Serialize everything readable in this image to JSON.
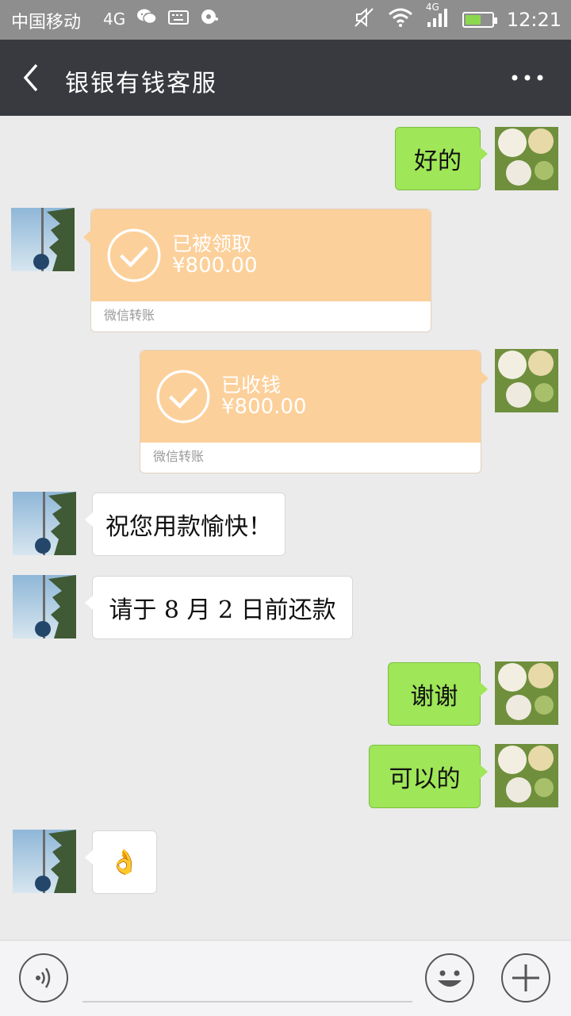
{
  "status_bar": {
    "carrier": "中国移动",
    "network_label": "4G",
    "signal_label": "4G",
    "time": "12:21",
    "battery_level": 0.6,
    "icons": [
      "wechat-icon",
      "keyboard-icon",
      "disk-icon",
      "mute-icon",
      "wifi-icon",
      "signal-icon",
      "battery-icon"
    ]
  },
  "header": {
    "title": "银银有钱客服",
    "back_icon": "chevron-left-icon",
    "more_icon": "more-dots-icon"
  },
  "messages": [
    {
      "side": "right",
      "type": "text",
      "text": "好的"
    },
    {
      "side": "left",
      "type": "transfer",
      "status": "已被领取",
      "amount": "¥800.00",
      "footer": "微信转账"
    },
    {
      "side": "right",
      "type": "transfer",
      "status": "已收钱",
      "amount": "¥800.00",
      "footer": "微信转账"
    },
    {
      "side": "left",
      "type": "text",
      "text": "祝您用款愉快！"
    },
    {
      "side": "left",
      "type": "text",
      "text": "请于 8 月 2 日前还款"
    },
    {
      "side": "right",
      "type": "text",
      "text": "谢谢"
    },
    {
      "side": "right",
      "type": "text",
      "text": "可以的"
    },
    {
      "side": "left",
      "type": "emoji",
      "text": "👌"
    }
  ],
  "input_bar": {
    "voice_icon": "voice-icon",
    "emoji_icon": "emoji-icon",
    "plus_icon": "plus-icon"
  },
  "colors": {
    "titlebar": "#393a3f",
    "green_bubble": "#9fe658",
    "transfer_orange": "#fcd09b",
    "background": "#ebebeb"
  }
}
